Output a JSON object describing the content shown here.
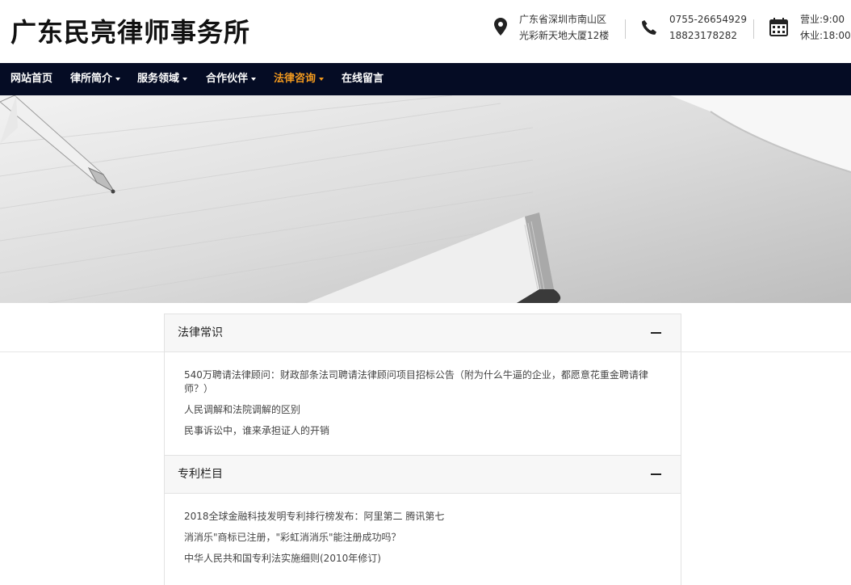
{
  "header": {
    "logo": "广东民亮律师事务所",
    "address": [
      "广东省深圳市南山区",
      "光彩新天地大厦12楼"
    ],
    "phones": [
      "0755-26654929",
      "18823178282"
    ],
    "hours": [
      "营业:9:00",
      "休业:18:00"
    ],
    "icons": [
      "location-pin-icon",
      "phone-icon",
      "calendar-icon"
    ]
  },
  "nav": {
    "items": [
      {
        "label": "网站首页",
        "dropdown": false,
        "active": false
      },
      {
        "label": "律所简介",
        "dropdown": true,
        "active": false
      },
      {
        "label": "服务领域",
        "dropdown": true,
        "active": false
      },
      {
        "label": "合作伙伴",
        "dropdown": true,
        "active": false
      },
      {
        "label": "法律咨询",
        "dropdown": true,
        "active": true
      },
      {
        "label": "在线留言",
        "dropdown": false,
        "active": false
      }
    ]
  },
  "panels": [
    {
      "title": "法律常识",
      "expanded": true,
      "items": [
        "540万聘请法律顾问：财政部条法司聘请法律顾问项目招标公告（附为什么牛逼的企业，都愿意花重金聘请律师？）",
        "人民调解和法院调解的区别",
        "民事诉讼中，谁来承担证人的开销"
      ]
    },
    {
      "title": "专利栏目",
      "expanded": true,
      "items": [
        "2018全球金融科技发明专利排行榜发布：阿里第二 腾讯第七",
        "消消乐\"商标已注册，\"彩虹消消乐\"能注册成功吗？",
        "中华人民共和国专利法实施细则(2010年修订)"
      ]
    }
  ],
  "colors": {
    "nav_bg": "#050c24",
    "nav_active": "#f39a1e",
    "panel_head_bg": "#f7f7f7"
  }
}
